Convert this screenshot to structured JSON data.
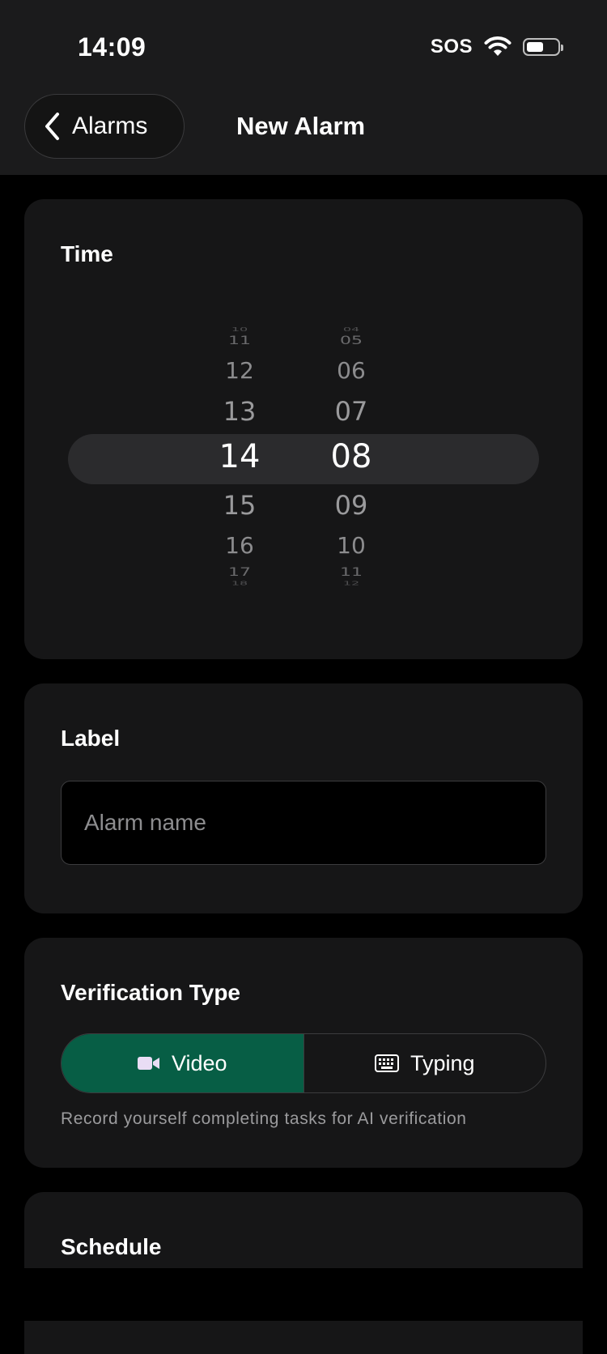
{
  "status_bar": {
    "time": "14:09",
    "sos": "SOS",
    "battery_level": 0.55
  },
  "nav": {
    "back_label": "Alarms",
    "title": "New Alarm"
  },
  "time_section": {
    "title": "Time",
    "hours": [
      "10",
      "11",
      "12",
      "13",
      "14",
      "15",
      "16",
      "17",
      "18"
    ],
    "minutes": [
      "04",
      "05",
      "06",
      "07",
      "08",
      "09",
      "10",
      "11",
      "12"
    ],
    "selected_hour": "14",
    "selected_minute": "08"
  },
  "label_section": {
    "title": "Label",
    "value": "",
    "placeholder": "Alarm name"
  },
  "verification_section": {
    "title": "Verification Type",
    "options": [
      {
        "label": "Video",
        "icon": "video-camera-icon",
        "selected": true
      },
      {
        "label": "Typing",
        "icon": "keyboard-icon",
        "selected": false
      }
    ],
    "help_text": "Record yourself completing tasks for AI verification"
  },
  "schedule_section": {
    "title": "Schedule"
  },
  "colors": {
    "accent": "#075e45",
    "background": "#000000",
    "card": "#161617",
    "header": "#1b1b1c"
  }
}
